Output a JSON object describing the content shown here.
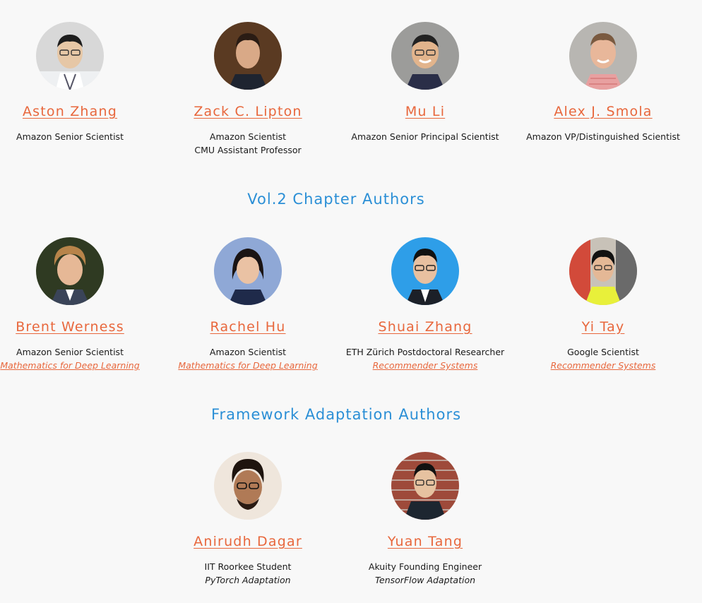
{
  "sections": {
    "vol2_title": "Vol.2 Chapter Authors",
    "framework_title": "Framework Adaptation Authors"
  },
  "authors": [
    {
      "name": "Aston Zhang",
      "role1": "Amazon Senior Scientist",
      "role2": ""
    },
    {
      "name": "Zack C. Lipton",
      "role1": "Amazon Scientist",
      "role2": "CMU Assistant Professor"
    },
    {
      "name": "Mu Li",
      "role1": "Amazon Senior Principal Scientist",
      "role2": ""
    },
    {
      "name": "Alex J. Smola",
      "role1": "Amazon VP/Distinguished Scientist",
      "role2": ""
    }
  ],
  "vol2_authors": [
    {
      "name": "Brent Werness",
      "role": "Amazon Senior Scientist",
      "book": "Mathematics for Deep Learning"
    },
    {
      "name": "Rachel Hu",
      "role": "Amazon Scientist",
      "book": "Mathematics for Deep Learning"
    },
    {
      "name": "Shuai Zhang",
      "role": "ETH Zürich Postdoctoral Researcher",
      "book": "Recommender Systems"
    },
    {
      "name": "Yi Tay",
      "role": "Google Scientist",
      "book": "Recommender Systems"
    }
  ],
  "framework_authors": [
    {
      "name": "Anirudh Dagar",
      "role": "IIT Roorkee Student",
      "adaptation": "PyTorch Adaptation"
    },
    {
      "name": "Yuan Tang",
      "role": "Akuity Founding Engineer",
      "adaptation": "TensorFlow Adaptation"
    }
  ],
  "colors": {
    "link": "#e8673c",
    "section_title": "#2b8fd6",
    "background": "#f8f8f8"
  }
}
